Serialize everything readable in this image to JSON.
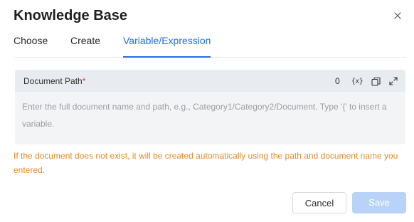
{
  "dialog": {
    "title": "Knowledge Base"
  },
  "tabs": [
    {
      "label": "Choose",
      "active": false
    },
    {
      "label": "Create",
      "active": false
    },
    {
      "label": "Variable/Expression",
      "active": true
    }
  ],
  "field": {
    "label": "Document Path",
    "required_mark": "*",
    "count": "0",
    "variable_icon": "{x}",
    "placeholder": "Enter the full document name and path, e.g., Category1/Category2/Document. Type '{' to insert a variable."
  },
  "warning": "If the document does not exist, it will be created automatically using the path and document name you entered.",
  "buttons": {
    "cancel": "Cancel",
    "save": "Save"
  },
  "icons": {
    "close": "close-icon",
    "variable": "variable-icon",
    "copy": "copy-icon",
    "expand": "expand-icon"
  },
  "colors": {
    "accent": "#1f6fe5",
    "warning": "#e38b2a",
    "required": "#e53935",
    "save_disabled": "#b8d3f7"
  }
}
